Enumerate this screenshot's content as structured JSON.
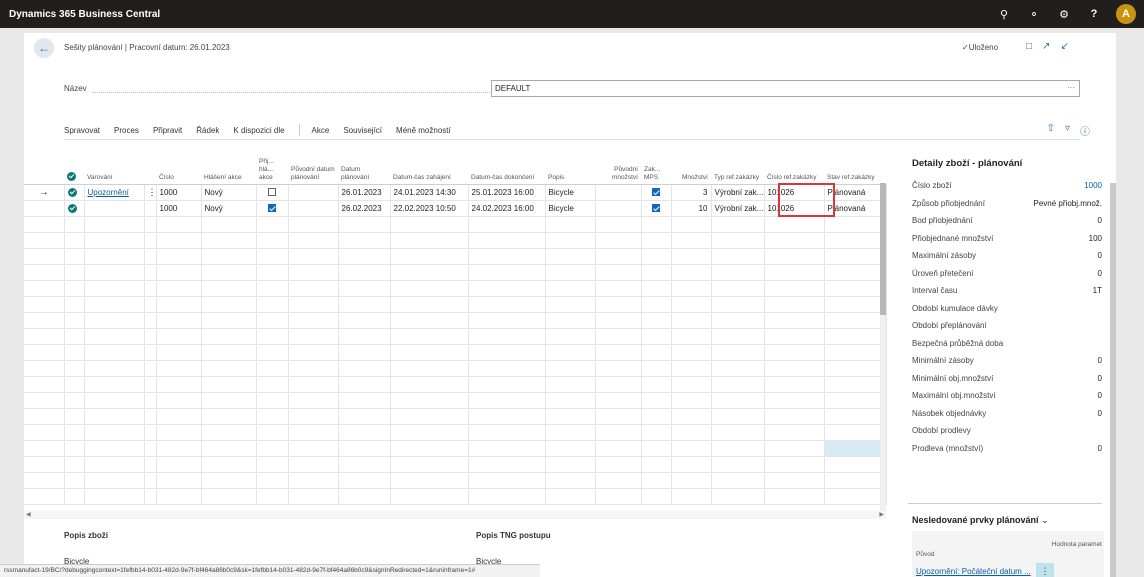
{
  "topbar": {
    "brand": "Dynamics 365 Business Central",
    "avatar_letter": "A",
    "icons": [
      "search-icon",
      "bell-icon",
      "gear-icon",
      "help-icon"
    ]
  },
  "header": {
    "breadcrumb": "Sešity plánování | Pracovní datum: 26.01.2023",
    "saved": "✓Uloženo"
  },
  "name_field": {
    "label": "Název",
    "value": "DEFAULT",
    "more": "···"
  },
  "actions": [
    "Spravovat",
    "Proces",
    "Připravit",
    "Řádek",
    "K dispozici dle",
    "Akce",
    "Související",
    "Méně možností"
  ],
  "grid": {
    "columns": [
      "Varování",
      "Číslo",
      "Hlášení akce",
      "Přij... hlá... akce",
      "Původní datum plánování",
      "Datum plánování",
      "Datum-čas zahájení",
      "Datum-čas dokončení",
      "Popis",
      "Původní množství",
      "Zak... MPS",
      "Množství",
      "Typ ref.zakázky",
      "Číslo ref.zakázky",
      "Stav ref.zakázky"
    ],
    "rows": [
      {
        "arrow": "→",
        "warning": "Upozornění",
        "number": "1000",
        "action": "Nový",
        "accept": false,
        "orig_date": "",
        "plan_date": "26.01.2023",
        "start": "24.01.2023 14:30",
        "end": "25.01.2023 16:00",
        "desc": "Bicycle",
        "orig_qty": "",
        "mps": true,
        "qty": "3",
        "ref_type": "Výrobní zak...",
        "ref_no": "101026",
        "ref_status": "Plánovaná"
      },
      {
        "arrow": "",
        "warning": "",
        "number": "1000",
        "action": "Nový",
        "accept": true,
        "orig_date": "",
        "plan_date": "26.02.2023",
        "start": "22.02.2023 10:50",
        "end": "24.02.2023 16:00",
        "desc": "Bicycle",
        "orig_qty": "",
        "mps": true,
        "qty": "10",
        "ref_type": "Výrobní zak...",
        "ref_no": "101026",
        "ref_status": "Plánovaná"
      }
    ]
  },
  "footer": {
    "item_desc_label": "Popis zboží",
    "item_desc_value": "Bicycle",
    "routing_label": "Popis TNG postupu",
    "routing_value": "Bicycle"
  },
  "factbox": {
    "title": "Detaily zboží - plánování",
    "rows": [
      {
        "label": "Číslo zboží",
        "value": "1000",
        "link": true
      },
      {
        "label": "Způsob přiobjednání",
        "value": "Pevné přiobj.množ.",
        "link": false
      },
      {
        "label": "Bod přiobjednání",
        "value": "0",
        "link": false
      },
      {
        "label": "Přiobjednané množství",
        "value": "100",
        "link": false
      },
      {
        "label": "Maximální zásoby",
        "value": "0",
        "link": false
      },
      {
        "label": "Úroveň přetečení",
        "value": "0",
        "link": false
      },
      {
        "label": "Interval času",
        "value": "1T",
        "link": false
      },
      {
        "label": "Období kumulace dávky",
        "value": "",
        "link": false
      },
      {
        "label": "Období přeplánování",
        "value": "",
        "link": false
      },
      {
        "label": "Bezpečná průběžná doba",
        "value": "",
        "link": false
      },
      {
        "label": "Minimální zásoby",
        "value": "0",
        "link": false
      },
      {
        "label": "Minimální obj.množství",
        "value": "0",
        "link": false
      },
      {
        "label": "Maximální obj.množství",
        "value": "0",
        "link": false
      },
      {
        "label": "Násobek objednávky",
        "value": "0",
        "link": false
      },
      {
        "label": "Období prodlevy",
        "value": "",
        "link": false
      },
      {
        "label": "Prodleva (množství)",
        "value": "0",
        "link": false
      }
    ],
    "untracked_title": "Nesledované prvky plánování",
    "untracked_col1": "Původ",
    "untracked_col2": "Hodnota paramet",
    "untracked_row": "Upozornění: Počáteční datum ..."
  },
  "statusbar": "rssmanufact-19/BC/?debuggingcontext=1fefbb14-b031-482d-9e7f-bf464a86b0c9&sk=1fefbb14-b031-482d-9e7f-bf464a86b0c9&signInRedirected=1&runinframe=1#"
}
